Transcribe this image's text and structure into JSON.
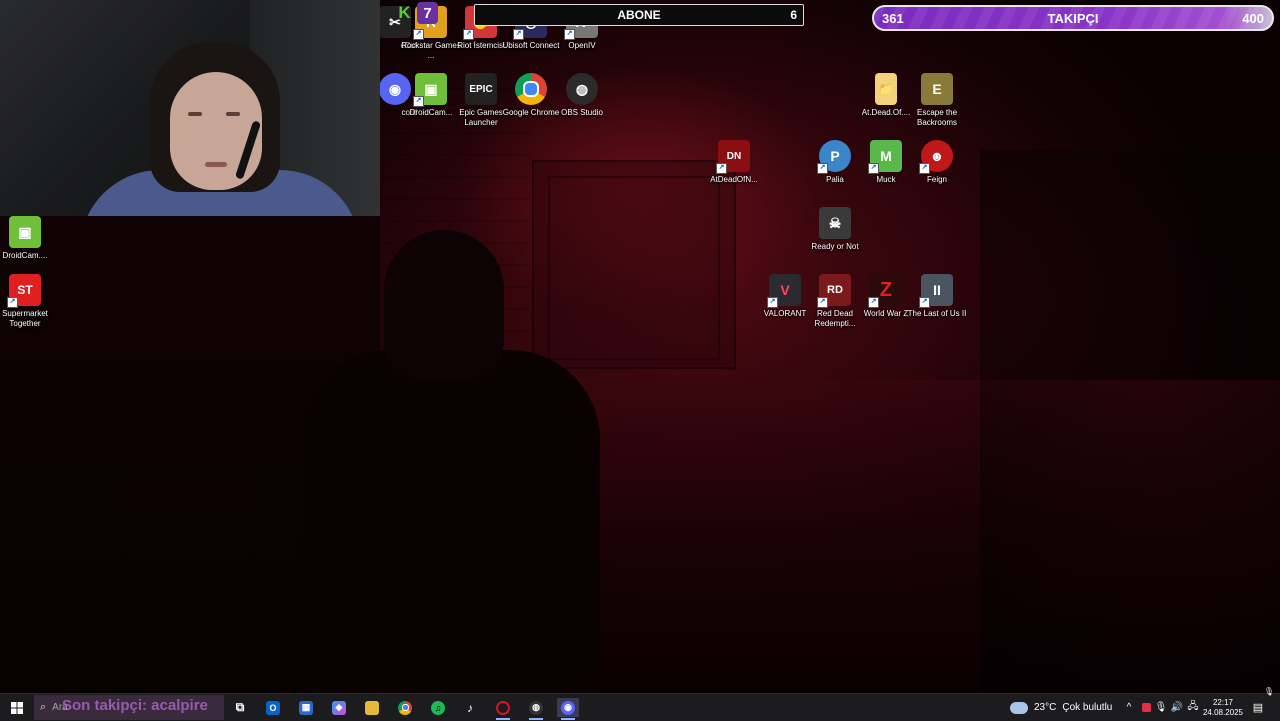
{
  "overlays": {
    "abone": {
      "label": "ABONE",
      "count": "6"
    },
    "takipci": {
      "current": "361",
      "label": "TAKIPÇI",
      "goal": "400",
      "progress": 0.9025
    }
  },
  "desktop": {
    "icons": [
      {
        "label": "cCut",
        "color": "#222222",
        "glyph": "✂"
      },
      {
        "label": "Rockstar Games ...",
        "color": "#e0a020",
        "glyph": "R"
      },
      {
        "label": "Riot İstemcisi",
        "color": "#d1363a",
        "glyph": "✊"
      },
      {
        "label": "Ubisoft Connect",
        "color": "#2a2a5a",
        "glyph": "◎"
      },
      {
        "label": "OpenIV",
        "color": "#777777",
        "glyph": "IV"
      },
      {
        "label": "cord",
        "color": "#5865f2",
        "glyph": "◉"
      },
      {
        "label": "DroidCam...",
        "color": "#6fbf3a",
        "glyph": "▣"
      },
      {
        "label": "Epic Games Launcher",
        "color": "#222222",
        "glyph": "EPIC"
      },
      {
        "label": "Google Chrome",
        "color": "#e8e8e8",
        "glyph": "●"
      },
      {
        "label": "OBS Studio",
        "color": "#2b2b2b",
        "glyph": "◍"
      },
      {
        "label": "AtDeadOfN...",
        "color": "#8b0f12",
        "glyph": "DN"
      },
      {
        "label": "At.Dead.Of....",
        "color": "#f2d27a",
        "glyph": "📁"
      },
      {
        "label": "Escape the Backrooms",
        "color": "#8a7a3a",
        "glyph": "E"
      },
      {
        "label": "Palia",
        "color": "#3a86c8",
        "glyph": "P"
      },
      {
        "label": "Muck",
        "color": "#58b84a",
        "glyph": "M"
      },
      {
        "label": "Feign",
        "color": "#c01818",
        "glyph": "☻"
      },
      {
        "label": "Ready or Not",
        "color": "#3a3a3a",
        "glyph": "☠"
      },
      {
        "label": "VALORANT",
        "color": "#2a2a30",
        "glyph": "V"
      },
      {
        "label": "Red Dead Redempti...",
        "color": "#7a1a1a",
        "glyph": "RD"
      },
      {
        "label": "World War Z",
        "color": "#2a0a0a",
        "glyph": "Z"
      },
      {
        "label": "The Last of Us II",
        "color": "#4a5560",
        "glyph": "II"
      },
      {
        "label": "DroidCam....",
        "color": "#6fbf3a",
        "glyph": "▣"
      },
      {
        "label": "Supermarket Together",
        "color": "#e02020",
        "glyph": "ST"
      }
    ],
    "top_badges": [
      {
        "glyph": "K",
        "color": "#53d12a"
      },
      {
        "glyph": "7",
        "color": "#6a2fa0"
      }
    ]
  },
  "taskbar": {
    "search_placeholder": "Ara",
    "search_banner": "Son takipçi: acalpire",
    "weather": {
      "temp": "23°C",
      "desc": "Çok bulutlu"
    },
    "clock": {
      "time": "22:17",
      "date": "24.08.2025"
    },
    "apps": [
      {
        "name": "task-view",
        "glyph": "⧉",
        "color": "#1c1c1f"
      },
      {
        "name": "outlook",
        "glyph": "O",
        "color": "#0a64c8"
      },
      {
        "name": "store",
        "glyph": "▦",
        "color": "#2a6ad0"
      },
      {
        "name": "copilot",
        "glyph": "◆",
        "color": "#7a58d8"
      },
      {
        "name": "file-explorer",
        "glyph": "▬",
        "color": "#e8b838"
      },
      {
        "name": "chrome",
        "glyph": "●",
        "color": "#2e9a48"
      },
      {
        "name": "spotify",
        "glyph": "♫",
        "color": "#1db954"
      },
      {
        "name": "tiktok",
        "glyph": "♪",
        "color": "#111111"
      },
      {
        "name": "opera-gx",
        "glyph": "O",
        "color": "#d01828"
      },
      {
        "name": "obs",
        "glyph": "◍",
        "color": "#333333"
      },
      {
        "name": "discord",
        "glyph": "◉",
        "color": "#5865f2"
      }
    ]
  },
  "colors": {
    "accent": "#8a33c8",
    "taskbar": "#1c1c1f"
  }
}
